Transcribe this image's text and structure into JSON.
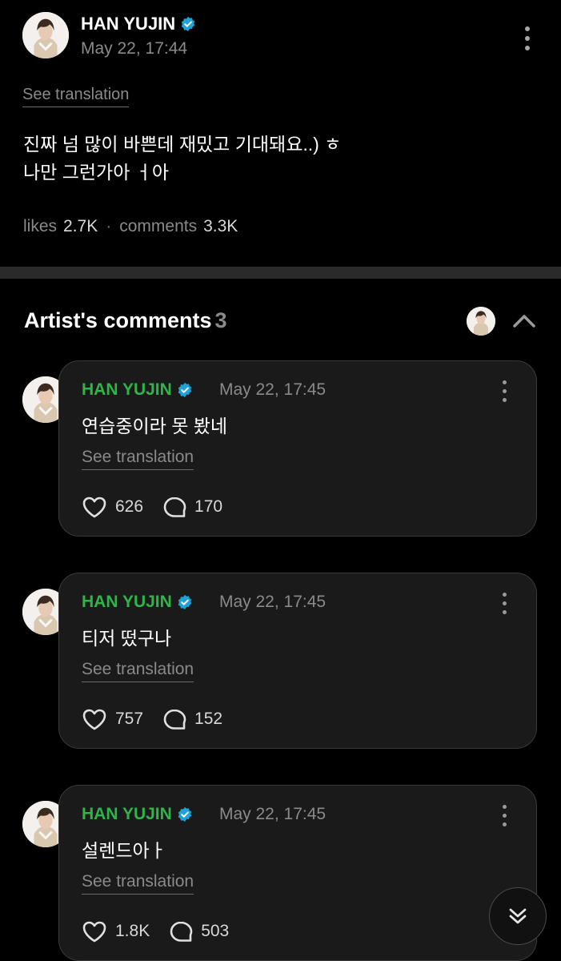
{
  "post": {
    "author": "HAN YUJIN",
    "date": "May 22, 17:44",
    "see_translation": "See translation",
    "body": "진짜 넘 많이 바쁜데 재밌고 기대돼요..) ㅎ\n나만 그런가아 ㅓ아",
    "likes_label": "likes",
    "likes_count": "2.7K",
    "comments_label": "comments",
    "comments_count": "3.3K"
  },
  "artist_comments": {
    "title": "Artist's comments",
    "count": "3",
    "items": [
      {
        "author": "HAN YUJIN",
        "date": "May 22, 17:45",
        "text": "연습중이라 못 봤네",
        "see_translation": "See translation",
        "likes": "626",
        "replies": "170"
      },
      {
        "author": "HAN YUJIN",
        "date": "May 22, 17:45",
        "text": "티저 떴구나",
        "see_translation": "See translation",
        "likes": "757",
        "replies": "152"
      },
      {
        "author": "HAN YUJIN",
        "date": "May 22, 17:45",
        "text": "설렌드아ㅏ",
        "see_translation": "See translation",
        "likes": "1.8K",
        "replies": "503"
      }
    ]
  },
  "colors": {
    "background": "#000000",
    "card": "#1a1a1a",
    "name_green": "#2fb44a",
    "verified_blue": "#1fa3d6",
    "muted": "#8a8a8a"
  },
  "icons": [
    "verified-badge-icon",
    "more-options-icon",
    "heart-icon",
    "reply-bubble-icon",
    "chevron-up-icon",
    "double-chevron-down-icon"
  ]
}
